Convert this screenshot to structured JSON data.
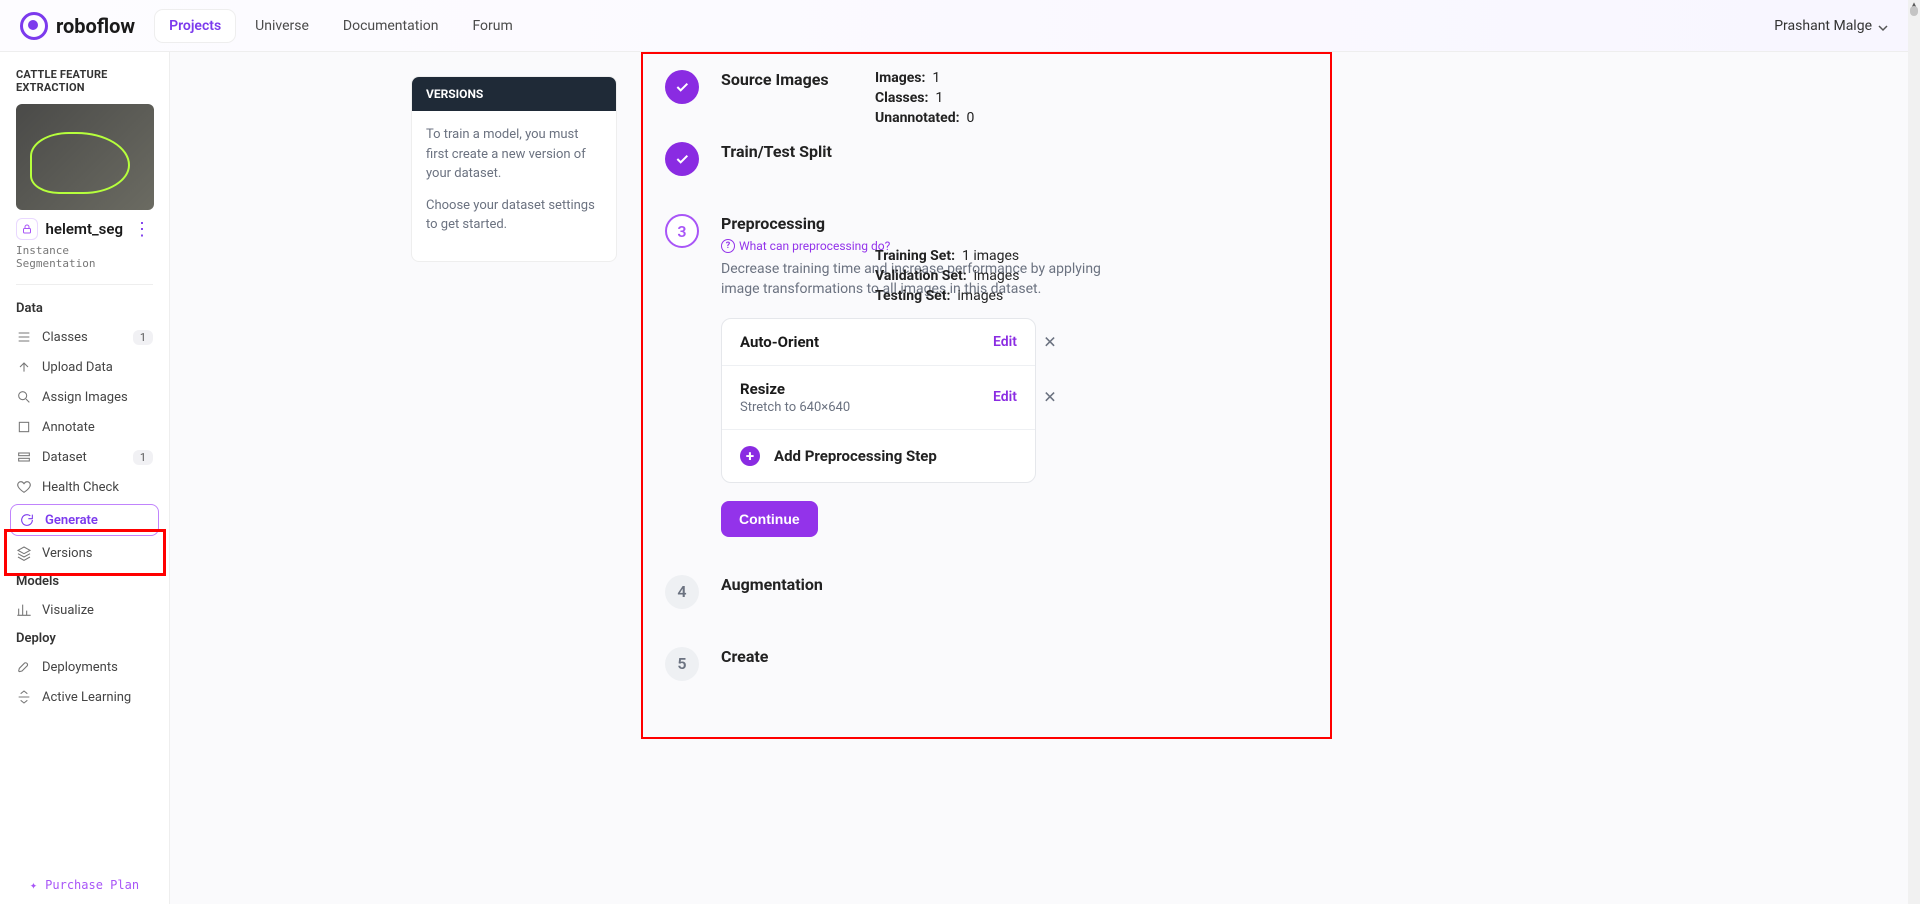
{
  "brand": "roboflow",
  "nav": {
    "projects": "Projects",
    "universe": "Universe",
    "documentation": "Documentation",
    "forum": "Forum"
  },
  "user_name": "Prashant Malge",
  "workspace": {
    "name": "CATTLE FEATURE EXTRACTION",
    "project_name": "helemt_seg",
    "project_type": "Instance Segmentation"
  },
  "sidebar": {
    "sections": {
      "data": "Data",
      "models": "Models",
      "deploy": "Deploy"
    },
    "items": {
      "classes": "Classes",
      "classes_badge": "1",
      "upload": "Upload Data",
      "assign": "Assign Images",
      "annotate": "Annotate",
      "dataset": "Dataset",
      "dataset_badge": "1",
      "health": "Health Check",
      "generate": "Generate",
      "versions": "Versions",
      "visualize": "Visualize",
      "deployments": "Deployments",
      "active_learning": "Active Learning"
    },
    "purchase": "Purchase Plan"
  },
  "versions_card": {
    "title": "VERSIONS",
    "p1": "To train a model, you must first create a new version of your dataset.",
    "p2": "Choose your dataset settings to get started."
  },
  "steps": {
    "source": {
      "title": "Source Images",
      "images_label": "Images:",
      "images_val": "1",
      "classes_label": "Classes:",
      "classes_val": "1",
      "unannotated_label": "Unannotated:",
      "unannotated_val": "0"
    },
    "split": {
      "title": "Train/Test Split",
      "train_label": "Training Set:",
      "train_val": "1 images",
      "valid_label": "Validation Set:",
      "valid_val": "images",
      "test_label": "Testing Set:",
      "test_val": "images"
    },
    "pre": {
      "num": "3",
      "title": "Preprocessing",
      "help": "What can preprocessing do?",
      "desc": "Decrease training time and increase performance by applying image transformations to all images in this dataset.",
      "auto_orient": "Auto-Orient",
      "resize": "Resize",
      "resize_detail": "Stretch to 640×640",
      "edit": "Edit",
      "add": "Add Preprocessing Step",
      "continue": "Continue"
    },
    "aug": {
      "num": "4",
      "title": "Augmentation"
    },
    "create": {
      "num": "5",
      "title": "Create"
    }
  }
}
